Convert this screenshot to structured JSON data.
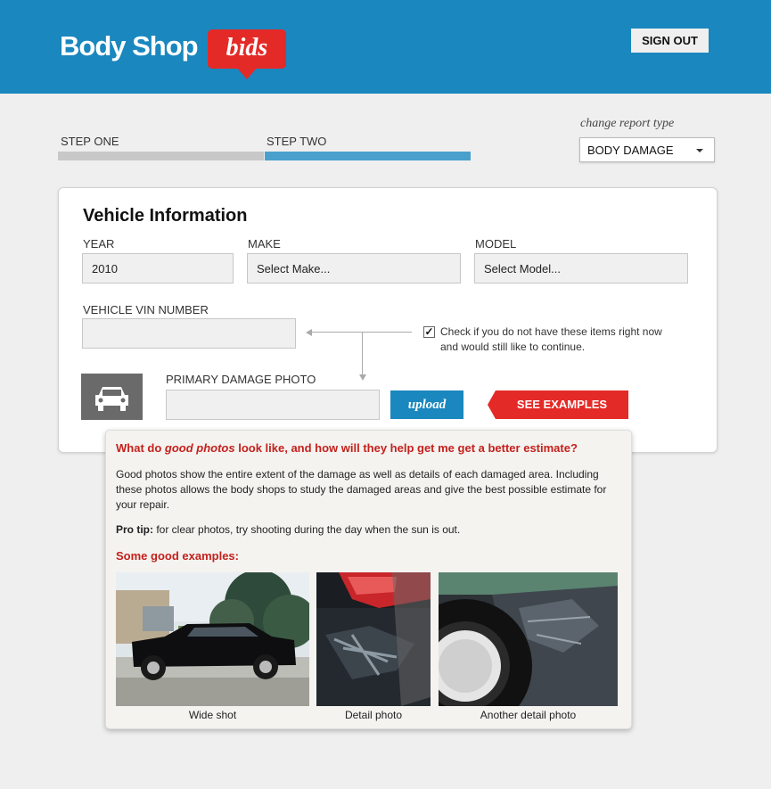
{
  "header": {
    "logo_text": "Body Shop",
    "logo_badge": "bids",
    "signout_label": "SIGN OUT",
    "bg_color": "#1a87be"
  },
  "steps": {
    "items": [
      {
        "label": "STEP ONE",
        "state": "completed",
        "color": "#c8c8c8"
      },
      {
        "label": "STEP TWO",
        "state": "active",
        "color": "#4aa0cd"
      }
    ]
  },
  "report_type": {
    "caption": "change report type",
    "selected": "BODY DAMAGE"
  },
  "vehicle": {
    "title": "Vehicle Information",
    "year_label": "YEAR",
    "year_value": "2010",
    "make_label": "MAKE",
    "make_value": "Select Make...",
    "model_label": "MODEL",
    "model_value": "Select Model...",
    "vin_label": "VEHICLE VIN NUMBER",
    "vin_value": "",
    "skip_text": "Check if you do not have these items right now and would still like to continue.",
    "skip_checked": true,
    "photo_label": "PRIMARY DAMAGE PHOTO",
    "photo_value": "",
    "upload_label": "upload",
    "examples_label": "SEE EXAMPLES"
  },
  "popover": {
    "question_prefix": "What do ",
    "question_em": "good photos",
    "question_suffix": " look like, and how will they help get me get a better estimate?",
    "body": "Good photos show the entire extent of the damage as well as details of each damaged area. Including these photos allows the body shops to study the damaged areas and give the best possible estimate for your repair.",
    "tip_label": "Pro tip:",
    "tip_text": " for clear photos, try shooting during the day when the sun is out.",
    "examples_title": "Some good examples:",
    "photos": [
      {
        "caption": "Wide shot"
      },
      {
        "caption": "Detail photo"
      },
      {
        "caption": "Another detail photo"
      }
    ]
  },
  "colors": {
    "accent_blue": "#1a87be",
    "accent_red": "#e42a27",
    "heading_red": "#c4211d"
  }
}
